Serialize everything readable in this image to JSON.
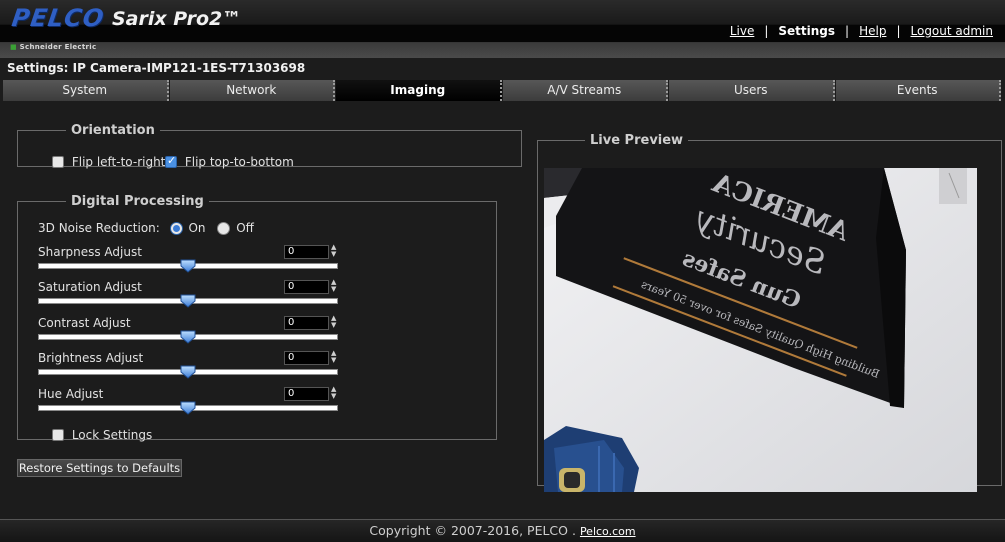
{
  "brand": {
    "logo": "PELCO",
    "product": "Sarix Pro2™",
    "vendor": "Schneider Electric"
  },
  "topnav": {
    "items": [
      {
        "label": "Live",
        "active": false
      },
      {
        "label": "Settings",
        "active": true
      },
      {
        "label": "Help",
        "active": false
      },
      {
        "label": "Logout admin",
        "active": false
      }
    ],
    "separator": "|"
  },
  "settings_title": "Settings: IP Camera-IMP121-1ES-T71303698",
  "tabs": [
    {
      "label": "System",
      "active": false
    },
    {
      "label": "Network",
      "active": false
    },
    {
      "label": "Imaging",
      "active": true
    },
    {
      "label": "A/V Streams",
      "active": false
    },
    {
      "label": "Users",
      "active": false
    },
    {
      "label": "Events",
      "active": false
    }
  ],
  "orientation": {
    "legend": "Orientation",
    "flip_lr": {
      "label": "Flip left-to-right",
      "checked": false
    },
    "flip_tb": {
      "label": "Flip top-to-bottom",
      "checked": true
    }
  },
  "digital_processing": {
    "legend": "Digital Processing",
    "noise_reduction": {
      "label": "3D Noise Reduction:",
      "on_label": "On",
      "off_label": "Off",
      "selected": "On"
    },
    "sliders": [
      {
        "label": "Sharpness Adjust",
        "value": "0",
        "fraction": 0.5
      },
      {
        "label": "Saturation Adjust",
        "value": "0",
        "fraction": 0.5
      },
      {
        "label": "Contrast Adjust",
        "value": "0",
        "fraction": 0.5
      },
      {
        "label": "Brightness Adjust",
        "value": "0",
        "fraction": 0.5
      },
      {
        "label": "Hue Adjust",
        "value": "0",
        "fraction": 0.5
      }
    ],
    "lock_settings": {
      "label": "Lock Settings",
      "checked": false
    }
  },
  "restore_button": "Restore Settings to Defaults",
  "live_preview": {
    "legend": "Live Preview",
    "banner_text": {
      "line1": "AMERICA",
      "line2": "Security",
      "line3": "Gun Safes",
      "line4": "Building High Quality Safes for over 50 Years"
    }
  },
  "footer": {
    "text": "Copyright © 2007-2016, PELCO .",
    "link": "Pelco.com"
  },
  "colors": {
    "accent": "#3a7bd5",
    "logo": "#2f5fc4",
    "background": "#1c1c1c"
  }
}
